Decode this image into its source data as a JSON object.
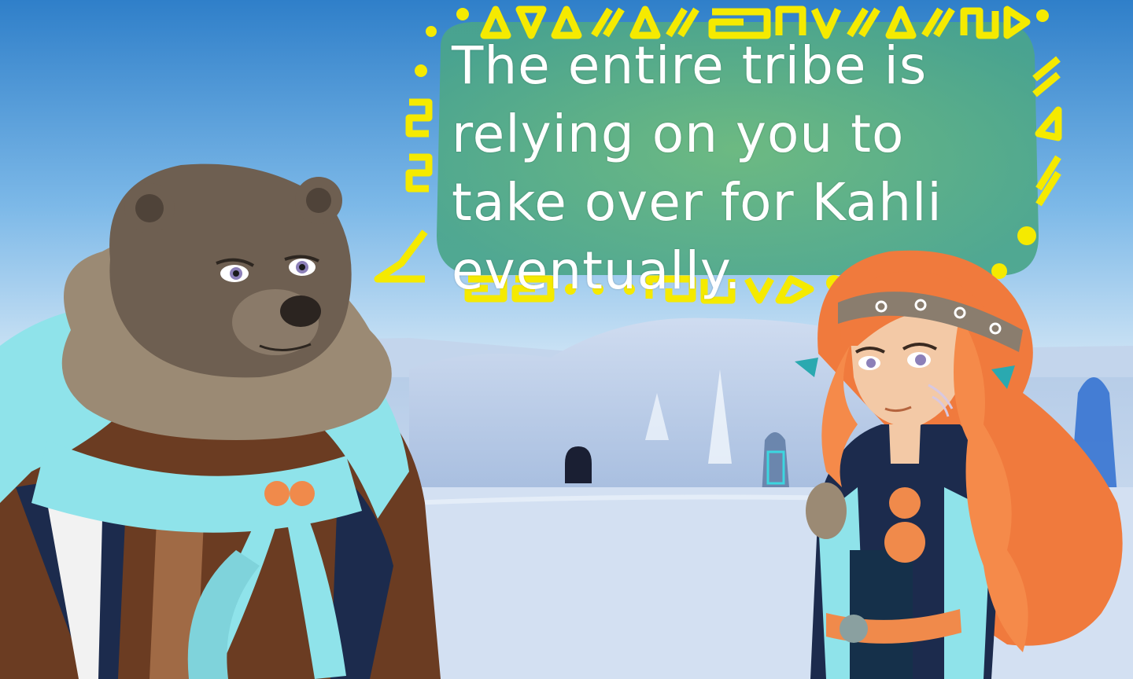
{
  "dialog": {
    "line": "The entire tribe is\nrelying on you to\ntake over for Kahli\neventually."
  },
  "colors": {
    "sky_top": "#2f7fc9",
    "sky_horizon": "#cfe5f5",
    "snow": "#c9d9ef",
    "bubble_fill": "#5fb27a",
    "ornament_yellow": "#f5ea00",
    "bear_fur": "#6e5f51",
    "bear_ruff": "#9b8a74",
    "hood_cyan": "#8fe3ea",
    "coat_brown": "#6b3c22",
    "coat_navy": "#1c2b4d",
    "bead_orange": "#f08a4b",
    "hair_orange": "#f07a3d",
    "skin": "#f3c9a6"
  },
  "icons": [
    "bear-character",
    "girl-character",
    "igloo",
    "carved-stone-totem",
    "dialog-bubble",
    "tribal-ornament-border"
  ]
}
